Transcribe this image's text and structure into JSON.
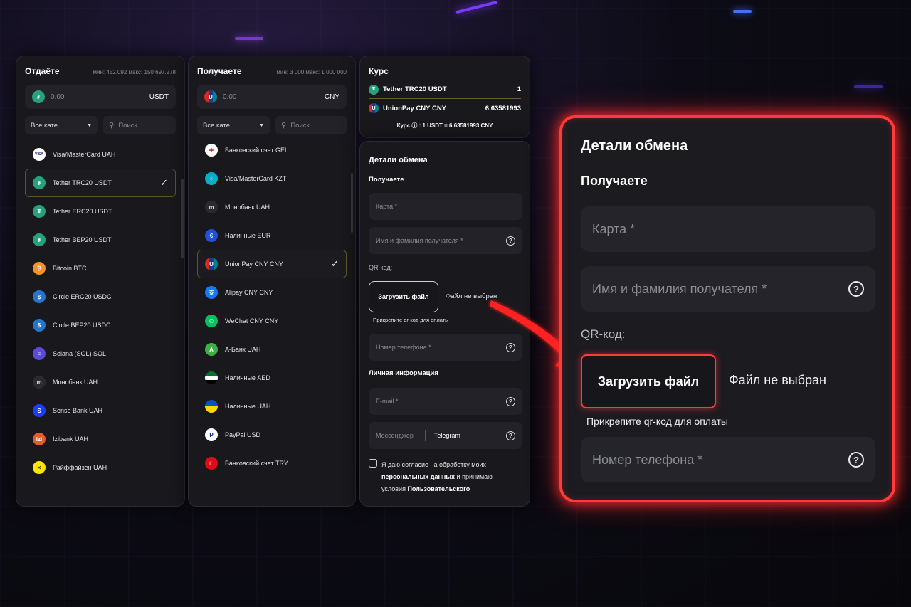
{
  "give": {
    "title": "Отдаёте",
    "limits": "мин: 452.092    макс: 150 697.278",
    "amount": "0.00",
    "currency": "USDT",
    "category": "Все кате...",
    "search_placeholder": "Поиск",
    "items": [
      {
        "label": "Visa/MasterCard UAH",
        "icon": "visa-icon"
      },
      {
        "label": "Tether TRC20 USDT",
        "icon": "tether-icon",
        "selected": true
      },
      {
        "label": "Tether ERC20 USDT",
        "icon": "tether-icon"
      },
      {
        "label": "Tether BEP20 USDT",
        "icon": "tether-icon"
      },
      {
        "label": "Bitcoin BTC",
        "icon": "bitcoin-icon"
      },
      {
        "label": "Circle ERC20 USDC",
        "icon": "usdc-icon"
      },
      {
        "label": "Circle BEP20 USDC",
        "icon": "usdc-icon"
      },
      {
        "label": "Solana (SOL) SOL",
        "icon": "solana-icon"
      },
      {
        "label": "Монобанк UAH",
        "icon": "monobank-icon"
      },
      {
        "label": "Sense Bank UAH",
        "icon": "sense-bank-icon"
      },
      {
        "label": "Izibank UAH",
        "icon": "izibank-icon"
      },
      {
        "label": "Райффайзен UAH",
        "icon": "raiffeisen-icon"
      }
    ]
  },
  "receive": {
    "title": "Получаете",
    "limits": "мин: 3 000    макс: 1 000 000",
    "amount": "0.00",
    "currency": "CNY",
    "category": "Все кате...",
    "search_placeholder": "Поиск",
    "items": [
      {
        "label": "Банковский счет GEL",
        "icon": "georgia-flag-icon"
      },
      {
        "label": "Visa/MasterCard KZT",
        "icon": "kazakhstan-flag-icon"
      },
      {
        "label": "Монобанк UAH",
        "icon": "monobank-icon"
      },
      {
        "label": "Наличные EUR",
        "icon": "euro-icon"
      },
      {
        "label": "UnionPay CNY CNY",
        "icon": "unionpay-icon",
        "selected": true
      },
      {
        "label": "Alipay CNY CNY",
        "icon": "alipay-icon"
      },
      {
        "label": "WeChat CNY CNY",
        "icon": "wechat-icon"
      },
      {
        "label": "А-Банк UAH",
        "icon": "a-bank-icon"
      },
      {
        "label": "Наличные AED",
        "icon": "uae-flag-icon"
      },
      {
        "label": "Наличные UAH",
        "icon": "ukraine-flag-icon"
      },
      {
        "label": "PayPal USD",
        "icon": "paypal-icon"
      },
      {
        "label": "Банковский счет TRY",
        "icon": "turkey-flag-icon"
      }
    ]
  },
  "rate": {
    "title": "Курс",
    "from_label": "Tether TRC20 USDT",
    "from_value": "1",
    "to_label": "UnionPay CNY CNY",
    "to_value": "6.63581993",
    "summary": "Курс ⓘ : 1 USDT = 6.63581993 CNY"
  },
  "details": {
    "title": "Детали обмена",
    "receive_section": "Получаете",
    "card_placeholder": "Карта *",
    "name_placeholder": "Имя и фамилия получателя *",
    "qr_label": "QR-код:",
    "upload_button": "Загрузить файл",
    "no_file": "Файл не выбран",
    "qr_hint": "Прикрепите qr-код для оплаты",
    "phone_placeholder": "Номер телефона *",
    "personal_section": "Личная информация",
    "email_placeholder": "E-mail *",
    "messenger_placeholder": "Мессенджер",
    "messenger_value": "Telegram",
    "consent_1": "Я даю согласие на обработку моих",
    "consent_2a": "персональных данных",
    "consent_2b": " и принимаю",
    "consent_3a": "условия ",
    "consent_3b": "Пользовательского"
  },
  "colors": {
    "accent_red": "#ff3a3a",
    "panel_bg": "#18181d",
    "selected_border": "#5b5530"
  }
}
